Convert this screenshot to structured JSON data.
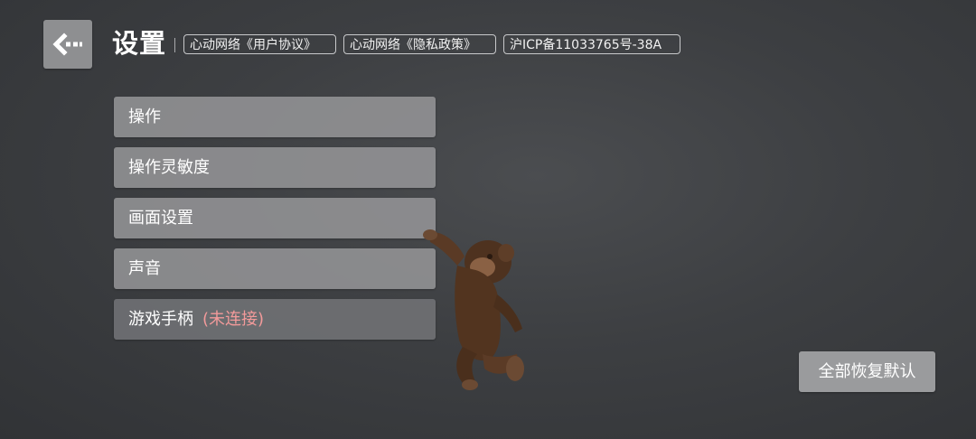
{
  "header": {
    "back_icon": "back-arrow-icon",
    "title": "设置",
    "links": [
      {
        "label": "心动网络《用户协议》"
      },
      {
        "label": "心动网络《隐私政策》"
      },
      {
        "label": "沪ICP备11033765号-38A"
      }
    ]
  },
  "menu": {
    "items": [
      {
        "label": "操作"
      },
      {
        "label": "操作灵敏度"
      },
      {
        "label": "画面设置"
      },
      {
        "label": "声音"
      },
      {
        "label": "游戏手柄",
        "status": "(未连接)"
      }
    ]
  },
  "reset_button": {
    "label": "全部恢复默认"
  },
  "colors": {
    "status_disconnected": "#f29a9a",
    "button_bg": "#9a9b9d",
    "background": "#3f4144"
  },
  "mascot": {
    "icon": "monkey-character-icon"
  }
}
